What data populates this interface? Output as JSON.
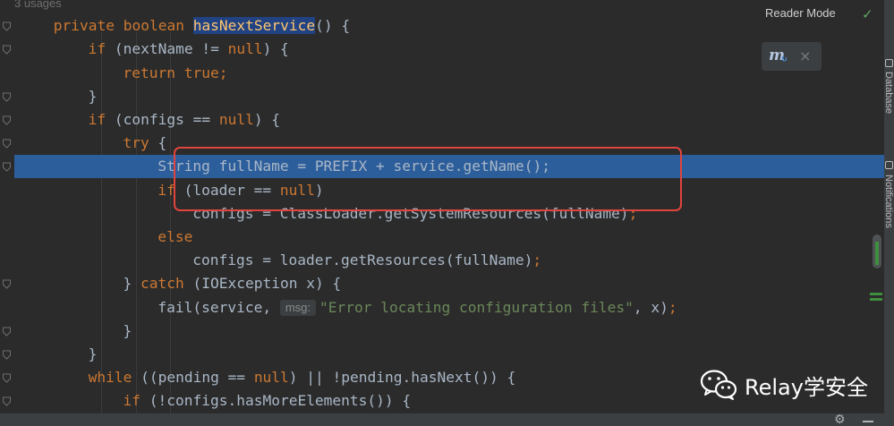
{
  "editor": {
    "usages_hint": "3 usages",
    "lines": [
      {
        "id": "l0",
        "indent": 0,
        "tokens": [
          {
            "t": "3 usages",
            "c": "usages"
          }
        ]
      },
      {
        "id": "l1",
        "indent": 2,
        "tokens": [
          {
            "t": "private boolean ",
            "c": "kw"
          },
          {
            "t": "hasNextService",
            "c": "mth sel-hl"
          },
          {
            "t": "() {",
            "c": ""
          }
        ]
      },
      {
        "id": "l2",
        "indent": 3,
        "tokens": [
          {
            "t": "if ",
            "c": "kw"
          },
          {
            "t": "(nextName != ",
            "c": ""
          },
          {
            "t": "null",
            "c": "kw"
          },
          {
            "t": ") {",
            "c": ""
          }
        ]
      },
      {
        "id": "l3",
        "indent": 4,
        "tokens": [
          {
            "t": "return true;",
            "c": "kw"
          }
        ]
      },
      {
        "id": "l4",
        "indent": 3,
        "tokens": [
          {
            "t": "}",
            "c": ""
          }
        ]
      },
      {
        "id": "l5",
        "indent": 3,
        "tokens": [
          {
            "t": "if ",
            "c": "kw"
          },
          {
            "t": "(configs == ",
            "c": ""
          },
          {
            "t": "null",
            "c": "kw"
          },
          {
            "t": ") {",
            "c": ""
          }
        ]
      },
      {
        "id": "l6",
        "indent": 4,
        "tokens": [
          {
            "t": "try ",
            "c": "kw"
          },
          {
            "t": "{",
            "c": ""
          }
        ]
      },
      {
        "id": "l7",
        "indent": 5,
        "exec": true,
        "tokens": [
          {
            "t": "String fullName = PREFIX + service.getName();",
            "c": ""
          }
        ]
      },
      {
        "id": "l8",
        "indent": 5,
        "tokens": [
          {
            "t": "if ",
            "c": "kw"
          },
          {
            "t": "(loader == ",
            "c": ""
          },
          {
            "t": "null",
            "c": "kw"
          },
          {
            "t": ")",
            "c": ""
          }
        ]
      },
      {
        "id": "l9",
        "indent": 6,
        "tokens": [
          {
            "t": "configs = ClassLoader.getSystemResources(fullName)",
            "c": ""
          },
          {
            "t": ";",
            "c": "kw"
          }
        ]
      },
      {
        "id": "l10",
        "indent": 5,
        "tokens": [
          {
            "t": "else",
            "c": "kw"
          }
        ]
      },
      {
        "id": "l11",
        "indent": 6,
        "tokens": [
          {
            "t": "configs = loader.getResources(fullName)",
            "c": ""
          },
          {
            "t": ";",
            "c": "kw"
          }
        ]
      },
      {
        "id": "l12",
        "indent": 4,
        "tokens": [
          {
            "t": "} ",
            "c": ""
          },
          {
            "t": "catch ",
            "c": "kw"
          },
          {
            "t": "(IOException x) {",
            "c": ""
          }
        ]
      },
      {
        "id": "l13",
        "indent": 5,
        "tokens": [
          {
            "t": "fail(service, ",
            "c": ""
          },
          {
            "t": "msg:",
            "c": "hint"
          },
          {
            "t": "\"Error locating configuration files\"",
            "c": "str"
          },
          {
            "t": ", x)",
            "c": ""
          },
          {
            "t": ";",
            "c": "kw"
          }
        ]
      },
      {
        "id": "l14",
        "indent": 4,
        "tokens": [
          {
            "t": "}",
            "c": ""
          }
        ]
      },
      {
        "id": "l15",
        "indent": 3,
        "tokens": [
          {
            "t": "}",
            "c": ""
          }
        ]
      },
      {
        "id": "l16",
        "indent": 3,
        "tokens": [
          {
            "t": "while ",
            "c": "kw"
          },
          {
            "t": "((pending == ",
            "c": ""
          },
          {
            "t": "null",
            "c": "kw"
          },
          {
            "t": ") || !pending.hasNext()) {",
            "c": ""
          }
        ]
      },
      {
        "id": "l17",
        "indent": 4,
        "tokens": [
          {
            "t": "if ",
            "c": "kw"
          },
          {
            "t": "(!configs.hasMoreElements()) {",
            "c": ""
          }
        ]
      }
    ]
  },
  "reader_mode": {
    "label": "Reader Mode",
    "check_icon": "checkmark-icon"
  },
  "plugin_popup": {
    "icon_text": "m",
    "icon": "maven-reload-icon",
    "close_icon": "close-icon",
    "close_glyph": "×"
  },
  "right_toolbar": {
    "tabs": [
      {
        "label": "Database",
        "icon": "database-icon"
      },
      {
        "label": "Notifications",
        "icon": "bell-icon"
      }
    ]
  },
  "bottom_bar": {
    "gear_icon": "gear-icon",
    "gear_glyph": "⚙",
    "minimize_icon": "minus-icon"
  },
  "watermark": {
    "text": "Relay学安全",
    "logo": "wechat-logo"
  },
  "colors": {
    "keyword": "#cc7832",
    "method": "#ffc66d",
    "string": "#6a8759",
    "text": "#a9b7c6",
    "exec_line": "#2d5e9c",
    "annotation_box": "#e0443e",
    "background": "#2b2b2b"
  }
}
